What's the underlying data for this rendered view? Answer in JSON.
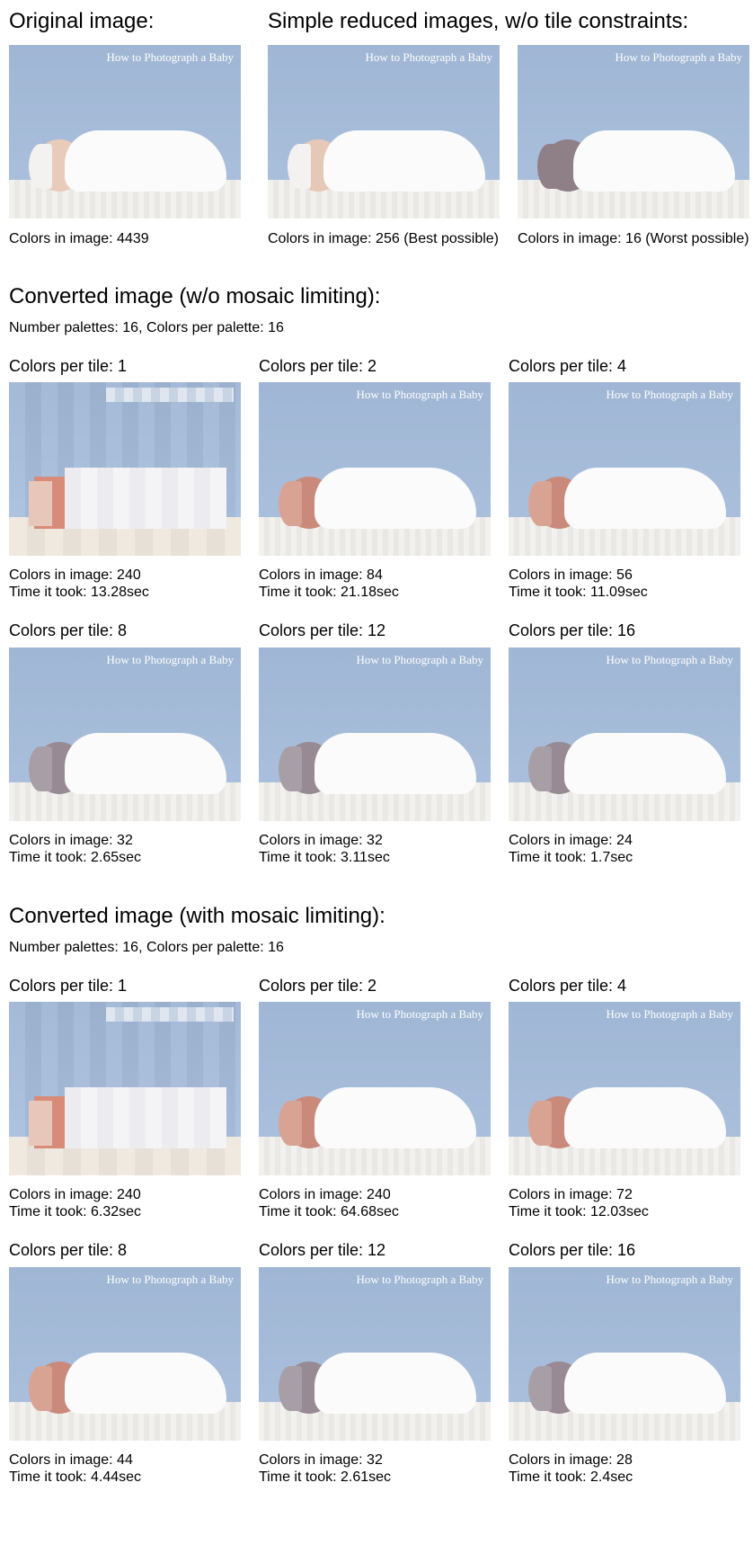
{
  "watermark": "How to Photograph a Baby",
  "original_section": {
    "title": "Original image:",
    "caption": "Colors in image: 4439"
  },
  "simple_section": {
    "title": "Simple reduced images, w/o tile constraints:",
    "captions": [
      "Colors in image: 256 (Best possible)",
      "Colors in image: 16 (Worst possible)"
    ]
  },
  "sections": [
    {
      "title": "Converted image (w/o mosaic limiting):",
      "subtitle": "Number palettes: 16,  Colors per palette: 16",
      "items": [
        {
          "label": "Colors per tile: 1",
          "colors": "Colors in image: 240",
          "time": "Time it took: 13.28sec"
        },
        {
          "label": "Colors per tile: 2",
          "colors": "Colors in image: 84",
          "time": "Time it took: 21.18sec"
        },
        {
          "label": "Colors per tile: 4",
          "colors": "Colors in image: 56",
          "time": "Time it took: 11.09sec"
        },
        {
          "label": "Colors per tile: 8",
          "colors": "Colors in image: 32",
          "time": "Time it took: 2.65sec"
        },
        {
          "label": "Colors per tile: 12",
          "colors": "Colors in image: 32",
          "time": "Time it took: 3.11sec"
        },
        {
          "label": "Colors per tile: 16",
          "colors": "Colors in image: 24",
          "time": "Time it took: 1.7sec"
        }
      ]
    },
    {
      "title": "Converted image (with mosaic limiting):",
      "subtitle": "Number palettes: 16,  Colors per palette: 16",
      "items": [
        {
          "label": "Colors per tile: 1",
          "colors": "Colors in image: 240",
          "time": "Time it took: 6.32sec"
        },
        {
          "label": "Colors per tile: 2",
          "colors": "Colors in image: 240",
          "time": "Time it took: 64.68sec"
        },
        {
          "label": "Colors per tile: 4",
          "colors": "Colors in image: 72",
          "time": "Time it took: 12.03sec"
        },
        {
          "label": "Colors per tile: 8",
          "colors": "Colors in image: 44",
          "time": "Time it took: 4.44sec"
        },
        {
          "label": "Colors per tile: 12",
          "colors": "Colors in image: 32",
          "time": "Time it took: 2.61sec"
        },
        {
          "label": "Colors per tile: 16",
          "colors": "Colors in image: 28",
          "time": "Time it took: 2.4sec"
        }
      ]
    }
  ]
}
